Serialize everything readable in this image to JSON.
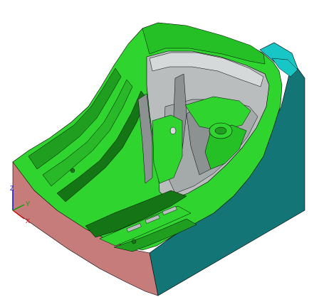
{
  "viewport": {
    "background": "#ffffff",
    "model": "mold-core-cavity",
    "colors": {
      "green_face": "#2fd42f",
      "green_shadow": "#1f9e1f",
      "green_dark": "#137513",
      "gray_wall": "#b9bdbd",
      "gray_dark": "#8c9292",
      "gray_light": "#d6d9d9",
      "teal_side": "#137575",
      "teal_top": "#19c6c6",
      "pink_side": "#c77c7c",
      "edge": "#000000"
    }
  },
  "triad": {
    "x_label": "X",
    "y_label": "Y",
    "z_label": "Z",
    "x_color": "#d40000",
    "y_color": "#00a000",
    "z_color": "#0000d4"
  }
}
